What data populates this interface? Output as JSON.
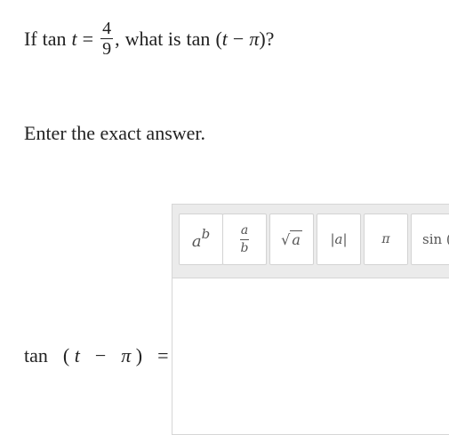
{
  "question": {
    "if": "If",
    "tan1": "tan",
    "t1": "t",
    "eq": "=",
    "frac_num": "4",
    "frac_den": "9",
    "comma": ",",
    "what_is": "what is",
    "tan2": "tan",
    "open_paren": "(",
    "t2": "t",
    "minus": "−",
    "pi": "π",
    "close_paren_q": ")?"
  },
  "instruction": "Enter the exact answer.",
  "answer_label": {
    "tan": "tan",
    "open_paren": "(",
    "t": "t",
    "minus": "−",
    "pi": "π",
    "close_paren": ")",
    "eq": "="
  },
  "toolbar": {
    "superscript": {
      "base": "a",
      "exp": "b"
    },
    "fraction": {
      "num": "a",
      "den": "b"
    },
    "sqrt": {
      "radical": "√",
      "radicand": "a"
    },
    "abs": "|a|",
    "pi": "π",
    "sin": "sin ("
  }
}
